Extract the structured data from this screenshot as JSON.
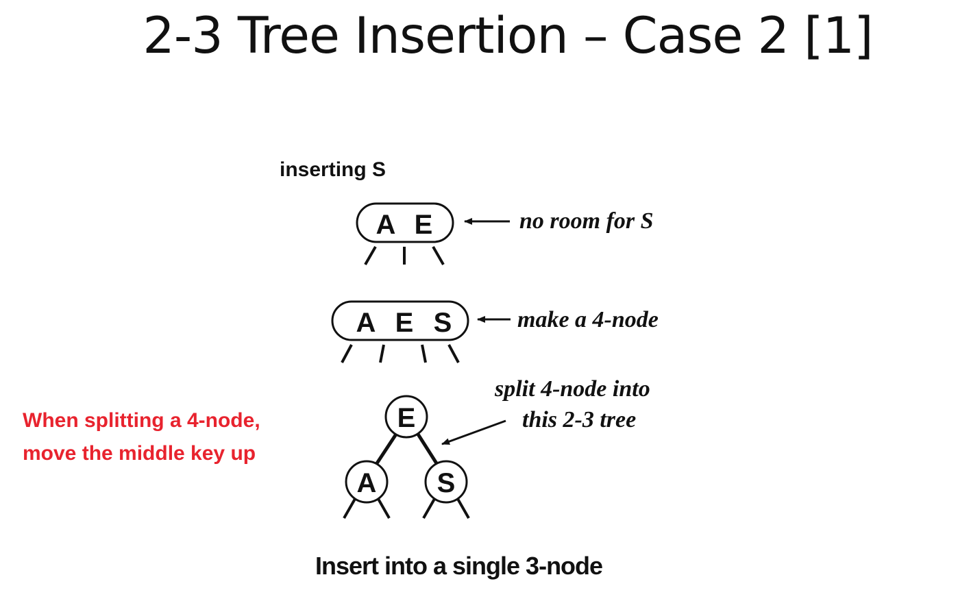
{
  "slide": {
    "title": "2-3 Tree Insertion – Case 2 [1]",
    "note_lines": [
      "When splitting a 4-node,",
      "move the middle key up"
    ],
    "note_color": "#e8232e"
  },
  "diagram": {
    "heading": "inserting S",
    "caption": "Insert into a single 3-node",
    "step1": {
      "keys": [
        "A",
        "E"
      ],
      "annotation": "no room for S"
    },
    "step2": {
      "keys": [
        "A",
        "E",
        "S"
      ],
      "annotation": "make a 4-node"
    },
    "step3": {
      "root": "E",
      "left": "A",
      "right": "S",
      "annotation_lines": [
        "split 4-node into",
        "this 2-3 tree"
      ]
    }
  }
}
